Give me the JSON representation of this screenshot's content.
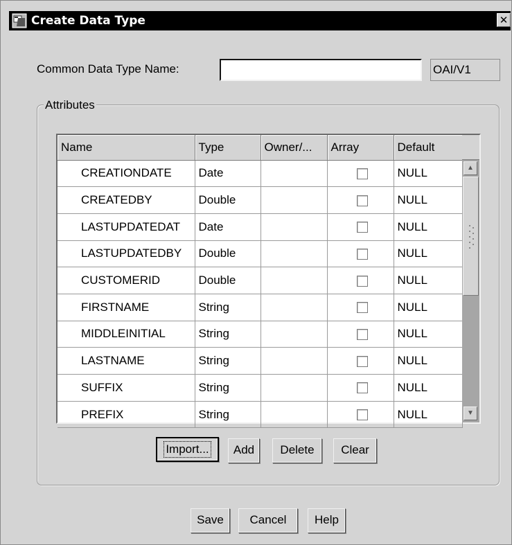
{
  "window": {
    "title": "Create Data Type",
    "close_glyph": "✕"
  },
  "form": {
    "name_label": "Common Data Type Name:",
    "name_value": "",
    "version": "OAI/V1"
  },
  "attributes": {
    "legend": "Attributes",
    "columns": [
      "Name",
      "Type",
      "Owner/...",
      "Array",
      "Default"
    ],
    "rows": [
      {
        "name": "CREATIONDATE",
        "type": "Date",
        "owner": "",
        "array": false,
        "default": "NULL"
      },
      {
        "name": "CREATEDBY",
        "type": "Double",
        "owner": "",
        "array": false,
        "default": "NULL"
      },
      {
        "name": "LASTUPDATEDAT",
        "type": "Date",
        "owner": "",
        "array": false,
        "default": "NULL"
      },
      {
        "name": "LASTUPDATEDBY",
        "type": "Double",
        "owner": "",
        "array": false,
        "default": "NULL"
      },
      {
        "name": "CUSTOMERID",
        "type": "Double",
        "owner": "",
        "array": false,
        "default": "NULL"
      },
      {
        "name": "FIRSTNAME",
        "type": "String",
        "owner": "",
        "array": false,
        "default": "NULL"
      },
      {
        "name": "MIDDLEINITIAL",
        "type": "String",
        "owner": "",
        "array": false,
        "default": "NULL"
      },
      {
        "name": "LASTNAME",
        "type": "String",
        "owner": "",
        "array": false,
        "default": "NULL"
      },
      {
        "name": "SUFFIX",
        "type": "String",
        "owner": "",
        "array": false,
        "default": "NULL"
      },
      {
        "name": "PREFIX",
        "type": "String",
        "owner": "",
        "array": false,
        "default": "NULL"
      }
    ],
    "buttons": {
      "import": "Import...",
      "add": "Add",
      "delete": "Delete",
      "clear": "Clear"
    }
  },
  "footer_buttons": {
    "save": "Save",
    "cancel": "Cancel",
    "help": "Help"
  },
  "icons": {
    "title": "window-app-icon",
    "close": "close-icon",
    "scroll_up": "chevron-up-icon",
    "scroll_down": "chevron-down-icon"
  },
  "colors": {
    "titlebar": "#000000",
    "dialog_bg": "#d4d4d4",
    "scroll_track": "#a6a6a6"
  }
}
